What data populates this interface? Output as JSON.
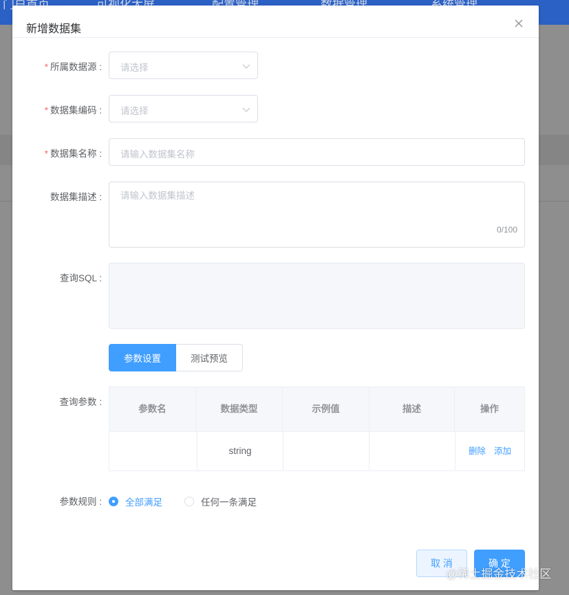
{
  "background": {
    "nav_items": [
      "门户首页",
      "可视化大屏",
      "配置管理",
      "数据管理",
      "系统管理"
    ]
  },
  "dialog": {
    "title": "新增数据集",
    "fields": {
      "datasource": {
        "label": "所属数据源 :",
        "placeholder": "请选择",
        "required": true
      },
      "dataset_code": {
        "label": "数据集编码 :",
        "placeholder": "请选择",
        "required": true
      },
      "dataset_name": {
        "label": "数据集名称 :",
        "placeholder": "请输入数据集名称",
        "required": true
      },
      "dataset_desc": {
        "label": "数据集描述 :",
        "placeholder": "请输入数据集描述",
        "counter": "0/100"
      },
      "query_sql": {
        "label": "查询SQL :"
      },
      "query_params": {
        "label": "查询参数 :"
      },
      "param_rule": {
        "label": "参数规则 :"
      }
    },
    "tabs": [
      {
        "label": "参数设置",
        "active": true
      },
      {
        "label": "测试预览",
        "active": false
      }
    ],
    "param_table": {
      "columns": [
        "参数名",
        "数据类型",
        "示例值",
        "描述",
        "操作"
      ],
      "rows": [
        {
          "name": "",
          "type": "string",
          "example": "",
          "desc": "",
          "actions": [
            "删除",
            "添加"
          ]
        }
      ]
    },
    "rule_options": [
      {
        "label": "全部满足",
        "selected": true
      },
      {
        "label": "任何一条满足",
        "selected": false
      }
    ],
    "buttons": {
      "cancel": "取 消",
      "confirm": "确 定"
    }
  },
  "watermark": "@稀土掘金技术社区",
  "colors": {
    "primary": "#409eff",
    "required": "#f56c6c",
    "header": "#2b60c4"
  }
}
